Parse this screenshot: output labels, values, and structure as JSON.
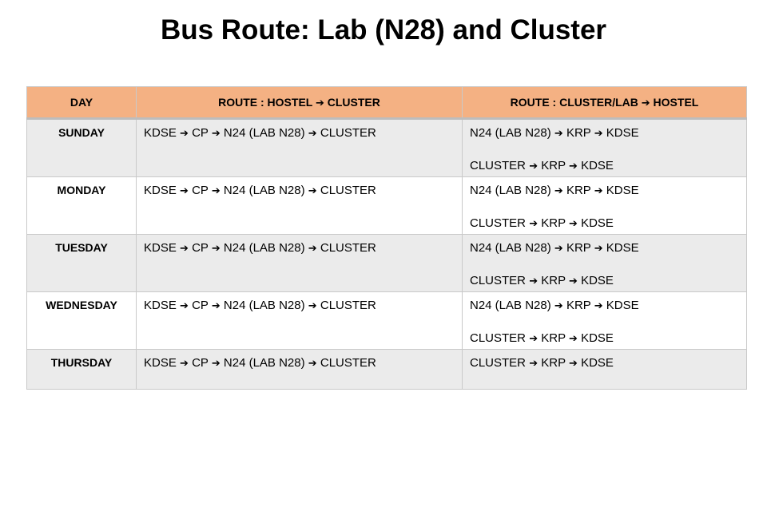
{
  "title": "Bus Route: Lab (N28) and Cluster",
  "table": {
    "headers": [
      "DAY",
      "ROUTE : HOSTEL ➔ CLUSTER",
      "ROUTE : CLUSTER/LAB ➔ HOSTEL"
    ],
    "rows": [
      {
        "day": "SUNDAY",
        "to_cluster": [
          "KDSE ➔ CP ➔ N24  (LAB N28) ➔ CLUSTER"
        ],
        "to_hostel": [
          "N24  (LAB N28) ➔ KRP ➔ KDSE",
          "CLUSTER  ➔ KRP ➔ KDSE"
        ]
      },
      {
        "day": "MONDAY",
        "to_cluster": [
          "KDSE ➔ CP ➔ N24  (LAB N28) ➔ CLUSTER"
        ],
        "to_hostel": [
          "N24  (LAB N28) ➔ KRP ➔ KDSE",
          "CLUSTER  ➔ KRP ➔ KDSE"
        ]
      },
      {
        "day": "TUESDAY",
        "to_cluster": [
          "KDSE ➔ CP ➔ N24  (LAB N28) ➔ CLUSTER"
        ],
        "to_hostel": [
          "N24  (LAB N28) ➔ KRP ➔ KDSE",
          "CLUSTER  ➔ KRP ➔ KDSE"
        ]
      },
      {
        "day": "WEDNESDAY",
        "to_cluster": [
          "KDSE ➔ CP ➔ N24  (LAB N28) ➔ CLUSTER"
        ],
        "to_hostel": [
          "N24  (LAB N28) ➔ KRP ➔ KDSE",
          "CLUSTER  ➔ KRP ➔ KDSE"
        ]
      },
      {
        "day": "THURSDAY",
        "to_cluster": [
          "KDSE ➔ CP ➔ N24  (LAB N28) ➔ CLUSTER"
        ],
        "to_hostel": [
          "CLUSTER  ➔ KRP ➔ KDSE"
        ]
      }
    ]
  },
  "colors": {
    "header_bg": "#f4b183",
    "alt_row_bg": "#ebebeb",
    "border": "#c9c9c9"
  }
}
